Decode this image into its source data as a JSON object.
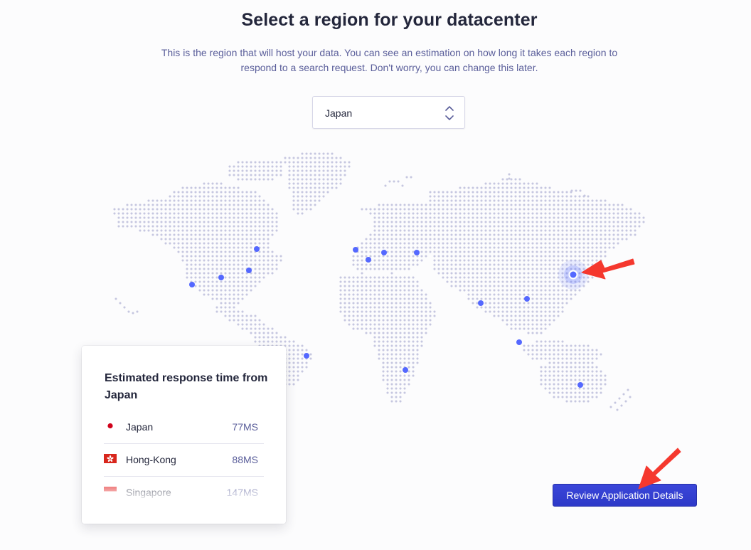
{
  "header": {
    "title": "Select a region for your datacenter",
    "subtitle": "This is the region that will host your data. You can see an estimation on how long it takes each region to respond to a search request. Don't worry, you can change this later."
  },
  "region_select": {
    "value": "Japan"
  },
  "response_card": {
    "title": "Estimated response time from Japan",
    "rows": [
      {
        "name": "Japan",
        "time": "77MS",
        "flag": "japan-flag-icon"
      },
      {
        "name": "Hong-Kong",
        "time": "88MS",
        "flag": "hong-kong-flag-icon"
      },
      {
        "name": "Singapore",
        "time": "147MS",
        "flag": "singapore-flag-icon"
      }
    ]
  },
  "footer": {
    "review_label": "Review Application Details"
  },
  "theme": {
    "accent": "#5468ff",
    "button": "#2d39c8",
    "map_dot": "#c6c7e0",
    "annotation_arrow": "#f5382e"
  },
  "map": {
    "selected_region": "Japan"
  }
}
